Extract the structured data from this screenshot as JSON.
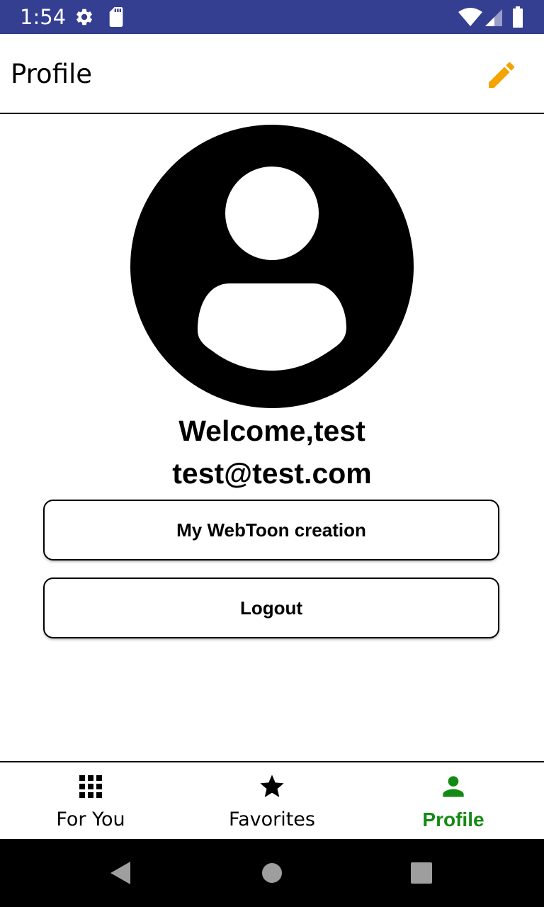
{
  "status_bar": {
    "time": "1:54",
    "icons": [
      "gear-icon",
      "sd-card-icon",
      "wifi-icon",
      "signal-icon",
      "battery-icon"
    ],
    "background_color": "#353f92"
  },
  "app_bar": {
    "title": "Profile",
    "edit_icon": "pencil-icon",
    "edit_icon_color": "#f5a300"
  },
  "profile": {
    "avatar_icon": "account-circle-icon",
    "welcome": "Welcome,test",
    "email": "test@test.com"
  },
  "buttons": {
    "webtoon_creation": "My WebToon creation",
    "logout": "Logout"
  },
  "bottom_nav": {
    "items": [
      {
        "label": "For You",
        "icon": "grid-icon",
        "active": false
      },
      {
        "label": "Favorites",
        "icon": "star-icon",
        "active": false
      },
      {
        "label": "Profile",
        "icon": "person-icon",
        "active": true
      }
    ],
    "active_color": "#138a13"
  },
  "system_nav": {
    "icons": [
      "back-icon",
      "home-icon",
      "recents-icon"
    ]
  }
}
